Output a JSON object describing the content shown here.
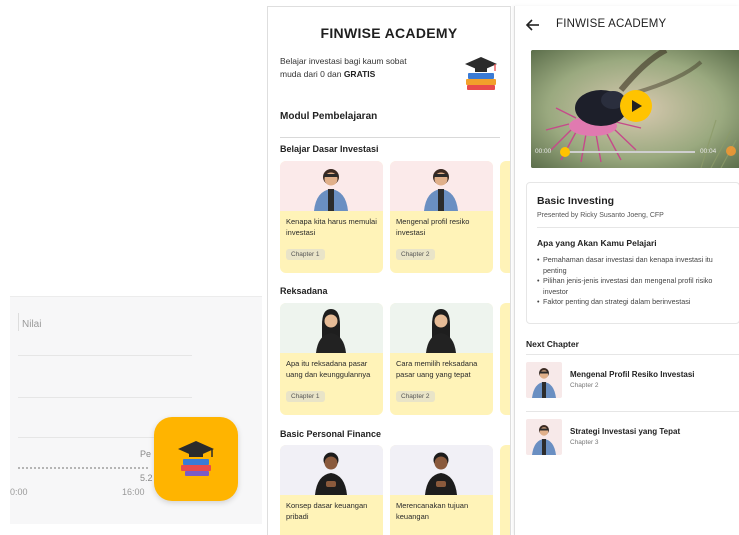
{
  "background": {
    "chart_label": "Nilai",
    "tick_left": "0:00",
    "tick_right": "16:00",
    "side_text_1": "Pe",
    "side_text_2": "5.2"
  },
  "colors": {
    "accent": "#ffc300",
    "app_icon_bg": "#ffb400",
    "card_bg": "#fff3b8"
  },
  "home": {
    "app_title": "FINWISE ACADEMY",
    "intro_line": "Belajar investasi bagi kaum sobat muda dari 0 dan",
    "intro_bold": "GRATIS",
    "module_heading": "Modul Pembelajaran",
    "categories": [
      {
        "title": "Belajar Dasar Investasi",
        "cards": [
          {
            "title": "Kenapa kita harus memulai investasi",
            "chapter": "Chapter 1"
          },
          {
            "title": "Mengenal profil resiko investasi",
            "chapter": "Chapter 2"
          }
        ]
      },
      {
        "title": "Reksadana",
        "cards": [
          {
            "title": "Apa itu reksadana pasar uang dan keunggulannya",
            "chapter": "Chapter 1"
          },
          {
            "title": "Cara memilih reksadana pasar uang yang tepat",
            "chapter": "Chapter 2"
          }
        ]
      },
      {
        "title": "Basic Personal Finance",
        "cards": [
          {
            "title": "Konsep dasar keuangan pribadi",
            "chapter": ""
          },
          {
            "title": "Merencanakan tujuan keuangan",
            "chapter": ""
          }
        ]
      }
    ]
  },
  "detail": {
    "app_title": "FINWISE ACADEMY",
    "video": {
      "time_current": "00:00",
      "time_total": "00:04",
      "progress": 0.0
    },
    "course_title": "Basic Investing",
    "presenter": "Presented by Ricky Susanto Joeng, CFP",
    "learn_heading": "Apa yang Akan Kamu Pelajari",
    "learn_items": [
      "Pemahaman dasar investasi dan kenapa investasi itu penting",
      "Pilihan jenis-jenis investasi dan mengenal profil risiko investor",
      "Faktor penting dan strategi dalam berinvestasi"
    ],
    "next_heading": "Next Chapter",
    "next_items": [
      {
        "title": "Mengenal Profil Resiko Investasi",
        "chapter": "Chapter 2"
      },
      {
        "title": "Strategi Investasi yang Tepat",
        "chapter": "Chapter 3"
      }
    ]
  }
}
